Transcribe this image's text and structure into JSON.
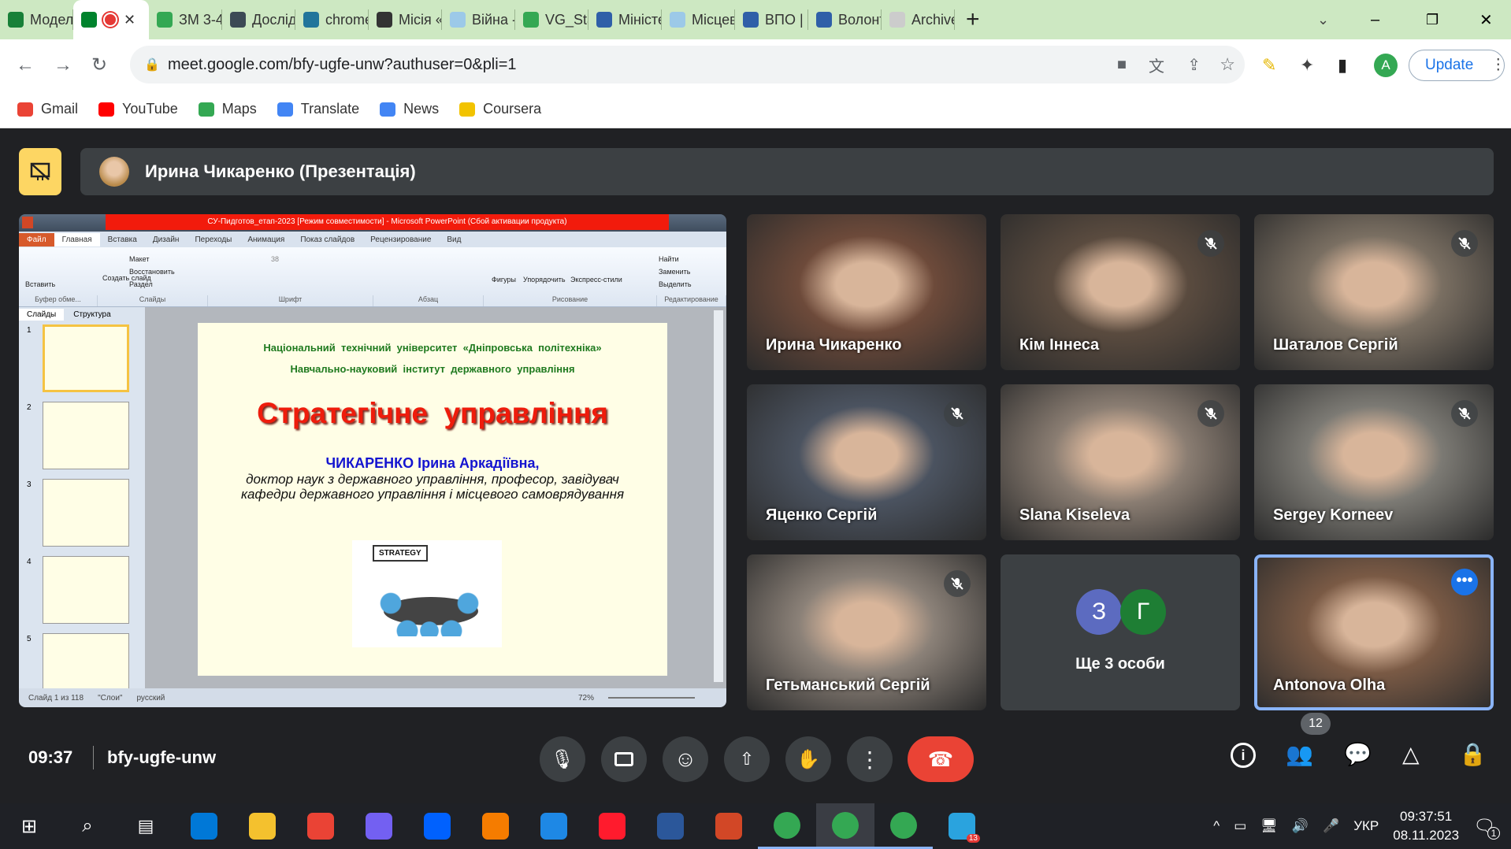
{
  "browser": {
    "tabs": [
      {
        "label": "Модел",
        "color": "#188038"
      },
      {
        "label": "",
        "color": "#00832d",
        "active": true,
        "recording": true
      },
      {
        "label": "ЗМ 3-4",
        "color": "#34a853"
      },
      {
        "label": "Дослід",
        "color": "#3c4a55"
      },
      {
        "label": "chrome",
        "color": "#21759b"
      },
      {
        "label": "Місія «",
        "color": "#333333"
      },
      {
        "label": "Війна -",
        "color": "#9cc9e8"
      },
      {
        "label": "VG_Sta",
        "color": "#34a853"
      },
      {
        "label": "Міністе",
        "color": "#2f5fa8"
      },
      {
        "label": "Місцев",
        "color": "#9cc9e8"
      },
      {
        "label": "ВПО |",
        "color": "#2f5fa8"
      },
      {
        "label": "Волонт",
        "color": "#2f5fa8"
      },
      {
        "label": "Archive",
        "color": "#cccccc"
      }
    ],
    "new_tab": "+",
    "url": "meet.google.com/bfy-ugfe-unw?authuser=0&pli=1",
    "update_label": "Update",
    "profile_initial": "A",
    "bookmarks": [
      {
        "label": "Gmail",
        "color": "#ea4335"
      },
      {
        "label": "YouTube",
        "color": "#ff0000"
      },
      {
        "label": "Maps",
        "color": "#34a853"
      },
      {
        "label": "Translate",
        "color": "#4285f4"
      },
      {
        "label": "News",
        "color": "#4285f4"
      },
      {
        "label": "Coursera",
        "color": "#f2c300"
      }
    ]
  },
  "meet": {
    "presenter_banner": "Ирина Чикаренко (Презентація)",
    "presentation": {
      "title_bar": "СУ-Пидготов_етап-2023 [Режим совместимости] - Microsoft PowerPoint (Сбой активации продукта)",
      "ribbon_tabs": [
        "Файл",
        "Главная",
        "Вставка",
        "Дизайн",
        "Переходы",
        "Анимация",
        "Показ слайдов",
        "Рецензирование",
        "Вид"
      ],
      "ribbon_groups": [
        "Буфер обме...",
        "Слайды",
        "Шрифт",
        "Абзац",
        "Рисование",
        "Редактирование"
      ],
      "ribbon_buttons": [
        "Вставить",
        "Создать слайд",
        "Макет",
        "Восстановить",
        "Раздел",
        "Фигуры",
        "Упорядочить",
        "Экспресс-стили",
        "Найти",
        "Заменить",
        "Выделить"
      ],
      "font_size": "38",
      "panel_tabs": [
        "Слайды",
        "Структура"
      ],
      "thumbnails": [
        "1",
        "2",
        "3",
        "4",
        "5"
      ],
      "slide": {
        "line1": "Національний  технічний  університет  «Дніпровська  політехніка»",
        "line2": "Навчально-науковий  інститут  державного  управління",
        "title": "Стратегічне  управління",
        "author": "ЧИКАРЕНКО Ірина Аркадіївна,",
        "desc": "доктор наук з державного управління, професор, завідувач кафедри державного управління і місцевого самоврядування",
        "image_label": "STRATEGY"
      },
      "status": {
        "slide": "Слайд 1 из 118",
        "theme": "\"Слои\"",
        "lang": "русский",
        "zoom": "72%"
      }
    },
    "participants": [
      {
        "name": "Ирина Чикаренко",
        "muted": false,
        "bg": "#6d4a3a"
      },
      {
        "name": "Кім Іннеса",
        "muted": true,
        "bg": "#5a4b3f"
      },
      {
        "name": "Шаталов Сергій",
        "muted": true,
        "bg": "#7a6f62"
      },
      {
        "name": "Яценко Сергій",
        "muted": true,
        "bg": "#4b5360"
      },
      {
        "name": "Slana Kiseleva",
        "muted": true,
        "bg": "#8a7d72"
      },
      {
        "name": "Sergey Korneev",
        "muted": true,
        "bg": "#7c7a74"
      },
      {
        "name": "Гетьманський Сергій",
        "muted": true,
        "bg": "#8b8178"
      },
      {
        "name": "Antonova Olha",
        "muted": false,
        "bg": "#7a5a45",
        "active": true
      }
    ],
    "others": {
      "label": "Ще 3 особи",
      "avatars": [
        {
          "letter": "З",
          "color": "#5c6bc0"
        },
        {
          "letter": "Г",
          "color": "#1e7e34"
        }
      ]
    },
    "time": "09:37",
    "meeting_code": "bfy-ugfe-unw",
    "people_count": "12",
    "end_call_color": "#ea4335"
  },
  "taskbar": {
    "apps": [
      "#0078d7",
      "#f4c12e",
      "#ea4335",
      "#7360f2",
      "#0061fe",
      "#f57c00",
      "#1e88e5",
      "#ff1b2d",
      "#2b579a",
      "#d24726",
      "#34a853",
      "#34a853",
      "#34a853",
      "#2aa3de"
    ],
    "telegram_badge": "13",
    "lang": "УКР",
    "clock": "09:37:51",
    "date": "08.11.2023",
    "notifications": "1"
  }
}
